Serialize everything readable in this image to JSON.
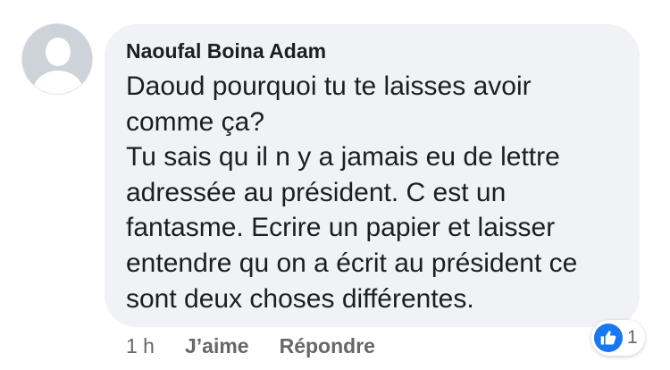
{
  "comment": {
    "author": "Naoufal Boina Adam",
    "message": "Daoud pourquoi tu te laisses avoir\ncomme ça?\nTu sais qu il n y a jamais eu de lettre\nadressée au président. C est un\nfantasme. Ecrire un papier   et laisser\nentendre qu on a écrit au président ce\nsont deux choses différentes.",
    "timestamp": "1 h",
    "actions": {
      "like_label": "J’aime",
      "reply_label": "Répondre"
    },
    "reactions": {
      "icon": "thumbs-up-icon",
      "count": "1",
      "color": "#1877f2"
    }
  },
  "colors": {
    "bubble_bg": "#f0f2f5",
    "text": "#1c1e21",
    "secondary_text": "#65676b"
  }
}
